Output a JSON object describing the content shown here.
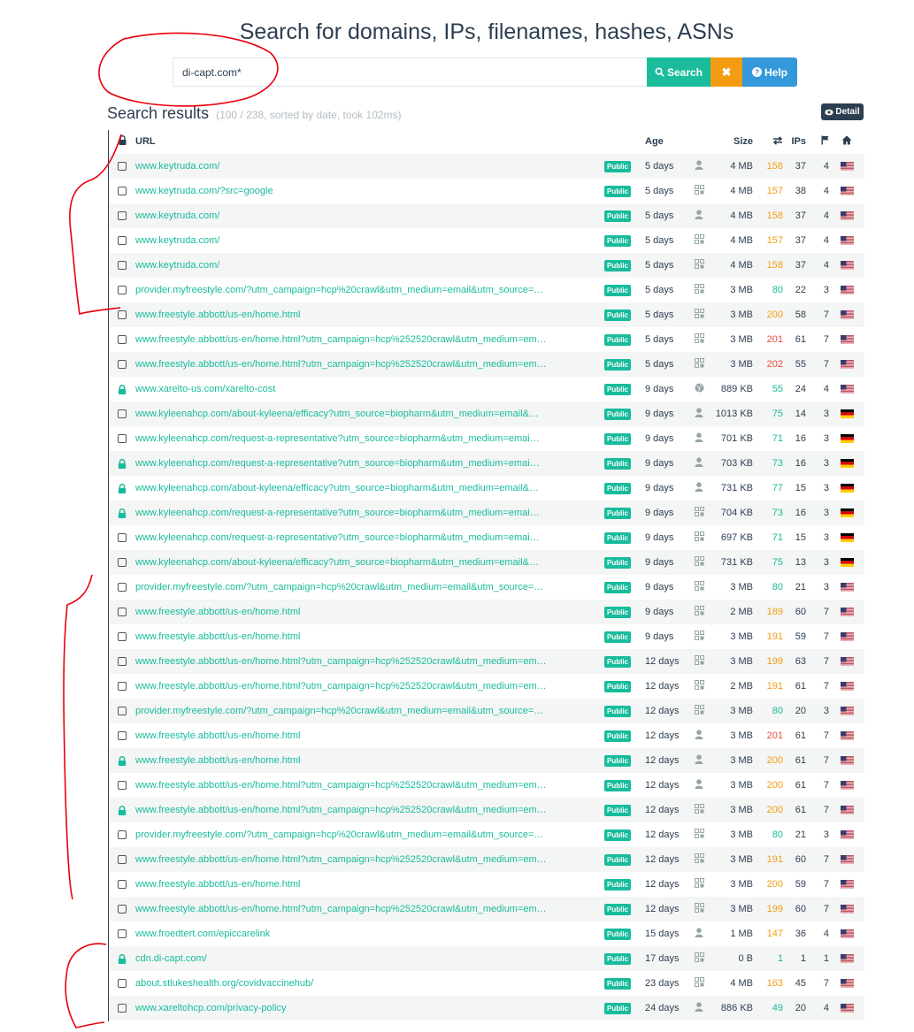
{
  "page": {
    "title": "Search for domains, IPs, filenames, hashes, ASNs"
  },
  "search": {
    "value": "di-capt.com*",
    "search_label": "Search",
    "clear_label": "✖",
    "help_label": "Help"
  },
  "results": {
    "heading": "Search results",
    "meta": "(100 / 238, sorted by date, took 102ms)",
    "detail_label": "Detail"
  },
  "columns": {
    "url": "URL",
    "age": "Age",
    "size": "Size",
    "ips": "IPs"
  },
  "colors": {
    "accent": "#18bc9c",
    "orange": "#f39c12",
    "red": "#e74c3c",
    "blue": "#3498db",
    "dark": "#2c3e50",
    "annotation": "#e8000b"
  },
  "rows": [
    {
      "lock": false,
      "url": "www.keytruda.com/",
      "badge": "Public",
      "age": "5 days",
      "icon": "user",
      "size": "4 MB",
      "req": "158",
      "reqc": "orange",
      "ips": "37",
      "cnt": "4",
      "flag": "us"
    },
    {
      "lock": false,
      "url": "www.keytruda.com/?src=google",
      "badge": "Public",
      "age": "5 days",
      "icon": "api",
      "size": "4 MB",
      "req": "157",
      "reqc": "orange",
      "ips": "38",
      "cnt": "4",
      "flag": "us"
    },
    {
      "lock": false,
      "url": "www.keytruda.com/",
      "badge": "Public",
      "age": "5 days",
      "icon": "user",
      "size": "4 MB",
      "req": "158",
      "reqc": "orange",
      "ips": "37",
      "cnt": "4",
      "flag": "us"
    },
    {
      "lock": false,
      "url": "www.keytruda.com/",
      "badge": "Public",
      "age": "5 days",
      "icon": "api",
      "size": "4 MB",
      "req": "157",
      "reqc": "orange",
      "ips": "37",
      "cnt": "4",
      "flag": "us"
    },
    {
      "lock": false,
      "url": "www.keytruda.com/",
      "badge": "Public",
      "age": "5 days",
      "icon": "api",
      "size": "4 MB",
      "req": "158",
      "reqc": "orange",
      "ips": "37",
      "cnt": "4",
      "flag": "us"
    },
    {
      "lock": false,
      "url": "provider.myfreestyle.com/?utm_campaign=hcp%20crawl&utm_medium=email&utm_source=…",
      "badge": "Public",
      "age": "5 days",
      "icon": "api",
      "size": "3 MB",
      "req": "80",
      "reqc": "green",
      "ips": "22",
      "cnt": "3",
      "flag": "us"
    },
    {
      "lock": false,
      "url": "www.freestyle.abbott/us-en/home.html",
      "badge": "Public",
      "age": "5 days",
      "icon": "api",
      "size": "3 MB",
      "req": "200",
      "reqc": "orange",
      "ips": "58",
      "cnt": "7",
      "flag": "us"
    },
    {
      "lock": false,
      "url": "www.freestyle.abbott/us-en/home.html?utm_campaign=hcp%252520crawl&utm_medium=em…",
      "badge": "Public",
      "age": "5 days",
      "icon": "api",
      "size": "3 MB",
      "req": "201",
      "reqc": "red",
      "ips": "61",
      "cnt": "7",
      "flag": "us"
    },
    {
      "lock": false,
      "url": "www.freestyle.abbott/us-en/home.html?utm_campaign=hcp%252520crawl&utm_medium=em…",
      "badge": "Public",
      "age": "5 days",
      "icon": "api",
      "size": "3 MB",
      "req": "202",
      "reqc": "red",
      "ips": "55",
      "cnt": "7",
      "flag": "us"
    },
    {
      "lock": true,
      "url": "www.xarelto-us.com/xarelto-cost",
      "badge": "Public",
      "age": "9 days",
      "icon": "globe",
      "size": "889 KB",
      "req": "55",
      "reqc": "green",
      "ips": "24",
      "cnt": "4",
      "flag": "us"
    },
    {
      "lock": false,
      "url": "www.kyleenahcp.com/about-kyleena/efficacy?utm_source=biopharm&utm_medium=email&…",
      "badge": "Public",
      "age": "9 days",
      "icon": "user",
      "size": "1013 KB",
      "req": "75",
      "reqc": "green",
      "ips": "14",
      "cnt": "3",
      "flag": "de"
    },
    {
      "lock": false,
      "url": "www.kyleenahcp.com/request-a-representative?utm_source=biopharm&utm_medium=emai…",
      "badge": "Public",
      "age": "9 days",
      "icon": "user",
      "size": "701 KB",
      "req": "71",
      "reqc": "green",
      "ips": "16",
      "cnt": "3",
      "flag": "de"
    },
    {
      "lock": true,
      "url": "www.kyleenahcp.com/request-a-representative?utm_source=biopharm&utm_medium=emai…",
      "badge": "Public",
      "age": "9 days",
      "icon": "user",
      "size": "703 KB",
      "req": "73",
      "reqc": "green",
      "ips": "16",
      "cnt": "3",
      "flag": "de"
    },
    {
      "lock": true,
      "url": "www.kyleenahcp.com/about-kyleena/efficacy?utm_source=biopharm&utm_medium=email&…",
      "badge": "Public",
      "age": "9 days",
      "icon": "user",
      "size": "731 KB",
      "req": "77",
      "reqc": "green",
      "ips": "15",
      "cnt": "3",
      "flag": "de"
    },
    {
      "lock": true,
      "url": "www.kyleenahcp.com/request-a-representative?utm_source=biopharm&utm_medium=emai…",
      "badge": "Public",
      "age": "9 days",
      "icon": "api",
      "size": "704 KB",
      "req": "73",
      "reqc": "green",
      "ips": "16",
      "cnt": "3",
      "flag": "de"
    },
    {
      "lock": false,
      "url": "www.kyleenahcp.com/request-a-representative?utm_source=biopharm&utm_medium=emai…",
      "badge": "Public",
      "age": "9 days",
      "icon": "api",
      "size": "697 KB",
      "req": "71",
      "reqc": "green",
      "ips": "15",
      "cnt": "3",
      "flag": "de"
    },
    {
      "lock": false,
      "url": "www.kyleenahcp.com/about-kyleena/efficacy?utm_source=biopharm&utm_medium=email&…",
      "badge": "Public",
      "age": "9 days",
      "icon": "api",
      "size": "731 KB",
      "req": "75",
      "reqc": "green",
      "ips": "13",
      "cnt": "3",
      "flag": "de"
    },
    {
      "lock": false,
      "url": "provider.myfreestyle.com/?utm_campaign=hcp%20crawl&utm_medium=email&utm_source=…",
      "badge": "Public",
      "age": "9 days",
      "icon": "api",
      "size": "3 MB",
      "req": "80",
      "reqc": "green",
      "ips": "21",
      "cnt": "3",
      "flag": "us"
    },
    {
      "lock": false,
      "url": "www.freestyle.abbott/us-en/home.html",
      "badge": "Public",
      "age": "9 days",
      "icon": "api",
      "size": "2 MB",
      "req": "189",
      "reqc": "orange",
      "ips": "60",
      "cnt": "7",
      "flag": "us"
    },
    {
      "lock": false,
      "url": "www.freestyle.abbott/us-en/home.html",
      "badge": "Public",
      "age": "9 days",
      "icon": "api",
      "size": "3 MB",
      "req": "191",
      "reqc": "orange",
      "ips": "59",
      "cnt": "7",
      "flag": "us"
    },
    {
      "lock": false,
      "url": "www.freestyle.abbott/us-en/home.html?utm_campaign=hcp%252520crawl&utm_medium=em…",
      "badge": "Public",
      "age": "12 days",
      "icon": "api",
      "size": "3 MB",
      "req": "199",
      "reqc": "orange",
      "ips": "63",
      "cnt": "7",
      "flag": "us"
    },
    {
      "lock": false,
      "url": "www.freestyle.abbott/us-en/home.html?utm_campaign=hcp%252520crawl&utm_medium=em…",
      "badge": "Public",
      "age": "12 days",
      "icon": "api",
      "size": "2 MB",
      "req": "191",
      "reqc": "orange",
      "ips": "61",
      "cnt": "7",
      "flag": "us"
    },
    {
      "lock": false,
      "url": "provider.myfreestyle.com/?utm_campaign=hcp%20crawl&utm_medium=email&utm_source=…",
      "badge": "Public",
      "age": "12 days",
      "icon": "api",
      "size": "3 MB",
      "req": "80",
      "reqc": "green",
      "ips": "20",
      "cnt": "3",
      "flag": "us"
    },
    {
      "lock": false,
      "url": "www.freestyle.abbott/us-en/home.html",
      "badge": "Public",
      "age": "12 days",
      "icon": "user",
      "size": "3 MB",
      "req": "201",
      "reqc": "red",
      "ips": "61",
      "cnt": "7",
      "flag": "us"
    },
    {
      "lock": true,
      "url": "www.freestyle.abbott/us-en/home.html",
      "badge": "Public",
      "age": "12 days",
      "icon": "user",
      "size": "3 MB",
      "req": "200",
      "reqc": "orange",
      "ips": "61",
      "cnt": "7",
      "flag": "us"
    },
    {
      "lock": false,
      "url": "www.freestyle.abbott/us-en/home.html?utm_campaign=hcp%252520crawl&utm_medium=em…",
      "badge": "Public",
      "age": "12 days",
      "icon": "user",
      "size": "3 MB",
      "req": "200",
      "reqc": "orange",
      "ips": "61",
      "cnt": "7",
      "flag": "us"
    },
    {
      "lock": true,
      "url": "www.freestyle.abbott/us-en/home.html?utm_campaign=hcp%252520crawl&utm_medium=em…",
      "badge": "Public",
      "age": "12 days",
      "icon": "api",
      "size": "3 MB",
      "req": "200",
      "reqc": "orange",
      "ips": "61",
      "cnt": "7",
      "flag": "us"
    },
    {
      "lock": false,
      "url": "provider.myfreestyle.com/?utm_campaign=hcp%20crawl&utm_medium=email&utm_source=…",
      "badge": "Public",
      "age": "12 days",
      "icon": "api",
      "size": "3 MB",
      "req": "80",
      "reqc": "green",
      "ips": "21",
      "cnt": "3",
      "flag": "us"
    },
    {
      "lock": false,
      "url": "www.freestyle.abbott/us-en/home.html?utm_campaign=hcp%252520crawl&utm_medium=em…",
      "badge": "Public",
      "age": "12 days",
      "icon": "api",
      "size": "3 MB",
      "req": "191",
      "reqc": "orange",
      "ips": "60",
      "cnt": "7",
      "flag": "us"
    },
    {
      "lock": false,
      "url": "www.freestyle.abbott/us-en/home.html",
      "badge": "Public",
      "age": "12 days",
      "icon": "api",
      "size": "3 MB",
      "req": "200",
      "reqc": "orange",
      "ips": "59",
      "cnt": "7",
      "flag": "us"
    },
    {
      "lock": false,
      "url": "www.freestyle.abbott/us-en/home.html?utm_campaign=hcp%252520crawl&utm_medium=em…",
      "badge": "Public",
      "age": "12 days",
      "icon": "api",
      "size": "3 MB",
      "req": "199",
      "reqc": "orange",
      "ips": "60",
      "cnt": "7",
      "flag": "us"
    },
    {
      "lock": false,
      "url": "www.froedtert.com/epiccarelink",
      "badge": "Public",
      "age": "15 days",
      "icon": "user",
      "size": "1 MB",
      "req": "147",
      "reqc": "orange",
      "ips": "36",
      "cnt": "4",
      "flag": "us"
    },
    {
      "lock": true,
      "url": "cdn.di-capt.com/",
      "badge": "Public",
      "age": "17 days",
      "icon": "api",
      "size": "0 B",
      "req": "1",
      "reqc": "green",
      "ips": "1",
      "cnt": "1",
      "flag": "us"
    },
    {
      "lock": false,
      "url": "about.stlukeshealth.org/covidvaccinehub/",
      "badge": "Public",
      "age": "23 days",
      "icon": "api",
      "size": "4 MB",
      "req": "163",
      "reqc": "orange",
      "ips": "45",
      "cnt": "7",
      "flag": "us"
    },
    {
      "lock": false,
      "url": "www.xareltohcp.com/privacy-policy",
      "badge": "Public",
      "age": "24 days",
      "icon": "user",
      "size": "886 KB",
      "req": "49",
      "reqc": "green",
      "ips": "20",
      "cnt": "4",
      "flag": "us"
    }
  ]
}
